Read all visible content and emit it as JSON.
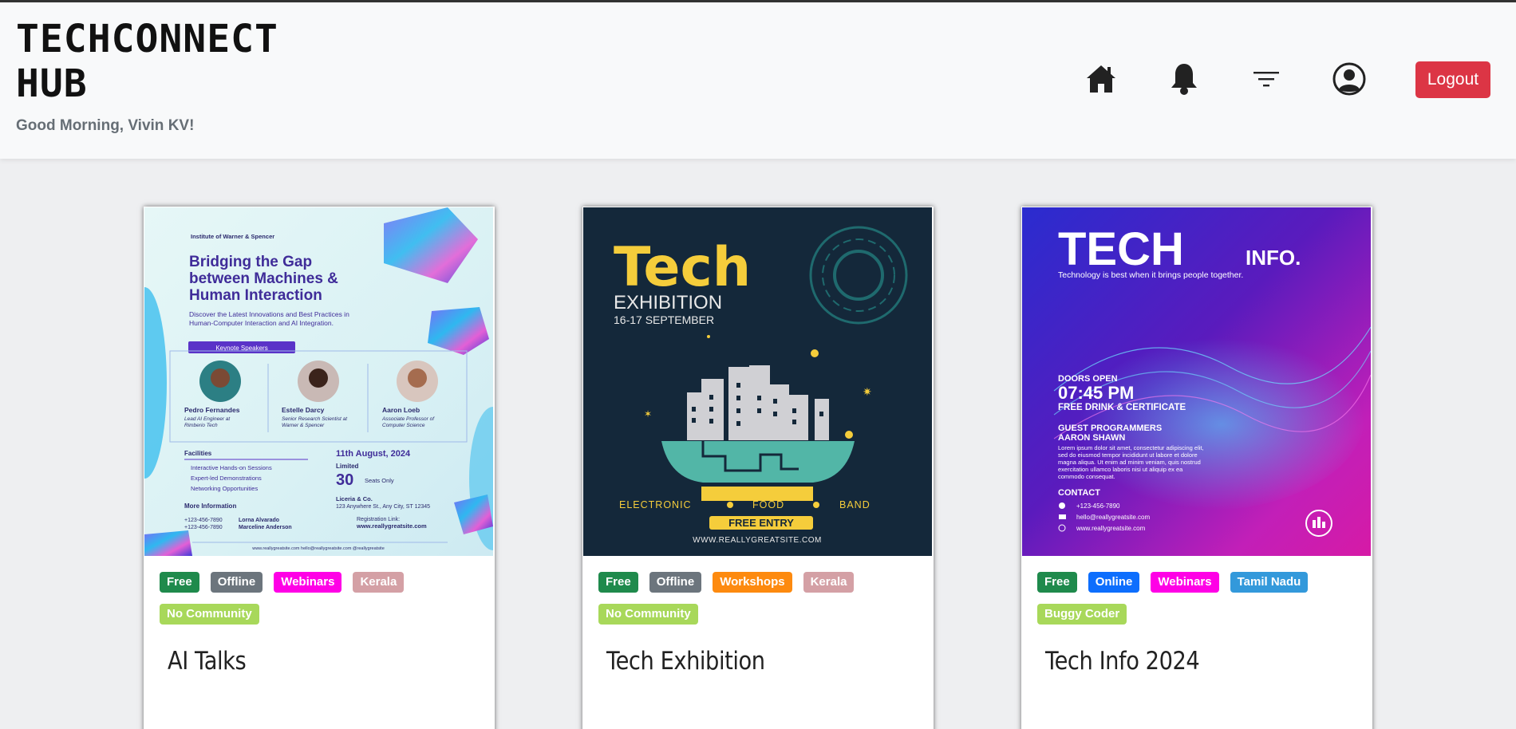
{
  "header": {
    "brand": "TECHCONNECT HUB",
    "greeting": "Good Morning, Vivin KV!",
    "nav": [
      {
        "icon": "home-icon"
      },
      {
        "icon": "bell-icon"
      },
      {
        "icon": "filter-icon"
      },
      {
        "icon": "user-icon"
      }
    ],
    "logout_label": "Logout"
  },
  "colors": {
    "free": "#1f8a4c",
    "offline": "#6c757d",
    "online": "#0d6efd",
    "webinars": "#ff00e6",
    "workshops": "#fd8a0f",
    "location": "#d4a0a5",
    "location_tn": "#3399db",
    "community": "#a8d85a",
    "logout": "#dc3545"
  },
  "events": [
    {
      "title": "AI Talks",
      "tags": [
        "Free",
        "Offline",
        "Webinars",
        "Kerala",
        "No Community"
      ],
      "poster": {
        "org": "Institute of Warner & Spencer",
        "headline": [
          "Bridging the Gap",
          "between Machines &",
          "Human Interaction"
        ],
        "sub": [
          "Discover the Latest Innovations and Best Practices in",
          "Human-Computer Interaction and AI Integration."
        ],
        "keynote": "Keynote Speakers",
        "speakers": [
          {
            "name": "Pedro Fernandes",
            "role": [
              "Lead AI Engineer at",
              "Rimberio Tech"
            ]
          },
          {
            "name": "Estelle Darcy",
            "role": [
              "Senior Research Scientist at",
              "Warner & Spencer"
            ]
          },
          {
            "name": "Aaron Loeb",
            "role": [
              "Associate Professor of",
              "Computer Science"
            ]
          }
        ],
        "facilities_label": "Facilities",
        "facilities": [
          "Interactive Hands-on Sessions",
          "Expert-led Demonstrations",
          "Networking Opportunities"
        ],
        "date": "11th August, 2024",
        "limited": "Limited",
        "seats_num": "30",
        "seats_text": "Seats Only",
        "more_info": "More Information",
        "contacts": [
          {
            "phone": "+123-456-7890",
            "name": "Lorna Alvarado"
          },
          {
            "phone": "+123-456-7890",
            "name": "Marceline Anderson"
          }
        ],
        "venue": [
          "Liceria & Co.",
          "123 Anywhere St., Any City, ST 12345"
        ],
        "reg_label": "Registration Link:",
        "reg_link": "www.reallygreatsite.com",
        "footer": "www.reallygreatsite.com     hello@reallygreatsite.com     @reallygreatsite"
      }
    },
    {
      "title": "Tech Exhibition",
      "tags": [
        "Free",
        "Offline",
        "Workshops",
        "Kerala",
        "No Community"
      ],
      "poster": {
        "big": "Tech",
        "sub": "EXHIBITION",
        "dates": "16-17 SEPTEMBER",
        "features": [
          "ELECTRONIC",
          "FOOD",
          "BAND"
        ],
        "entry": "FREE ENTRY",
        "site": "WWW.REALLYGREATSITE.COM"
      }
    },
    {
      "title": "Tech Info 2024",
      "tags": [
        "Free",
        "Online",
        "Webinars",
        "Tamil Nadu",
        "Buggy Coder"
      ],
      "poster": {
        "big": "TECH",
        "small": "INFO.",
        "tagline": "Technology is best when it brings people together.",
        "doors_label": "DOORS OPEN",
        "time": "07:45 PM",
        "perk": "FREE DRINK & CERTIFICATE",
        "guest_label": "GUEST PROGRAMMERS",
        "guest_name": "AARON SHAWN",
        "lorem": [
          "Lorem ipsum dolor sit amet, consectetur adipiscing elit,",
          "sed do eiusmod tempor incididunt ut labore et dolore",
          "magna aliqua. Ut enim ad minim veniam, quis nostrud",
          "exercitation ullamco laboris nisi ut aliquip ex ea",
          "commodo consequat."
        ],
        "contact_label": "CONTACT",
        "phone": "+123-456-7890",
        "email": "hello@reallygreatsite.com",
        "site": "www.reallygreatsite.com"
      }
    }
  ]
}
